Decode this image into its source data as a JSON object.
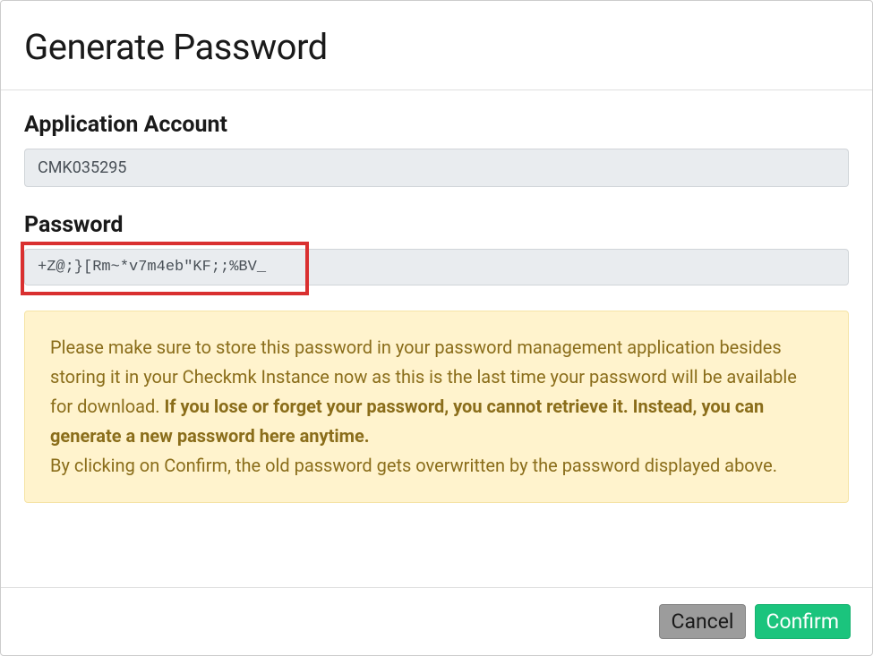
{
  "header": {
    "title": "Generate Password"
  },
  "fields": {
    "account": {
      "label": "Application Account",
      "value": "CMK035295"
    },
    "password": {
      "label": "Password",
      "value": "+Z@;}[Rm~*v7m4eb\"KF;;%BV_"
    }
  },
  "alert": {
    "text_before": "Please make sure to store this password in your password management application besides storing it in your Checkmk Instance now as this is the last time your password will be available for download. ",
    "text_strong": "If you lose or forget your password, you cannot retrieve it. Instead, you can generate a new password here anytime.",
    "text_after": "By clicking on Confirm, the old password gets overwritten by the password displayed above."
  },
  "footer": {
    "cancel_label": "Cancel",
    "confirm_label": "Confirm"
  }
}
